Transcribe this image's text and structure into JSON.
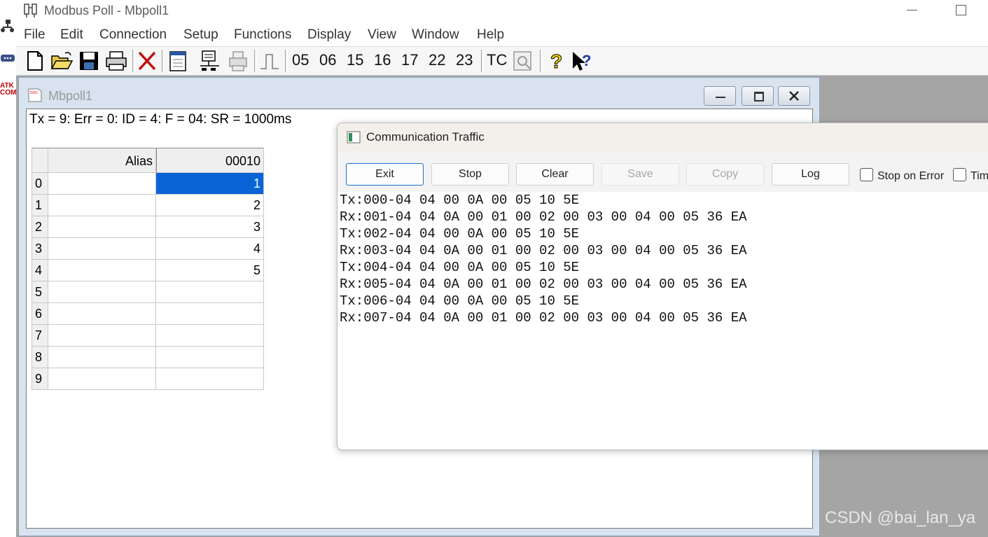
{
  "window": {
    "title": "Modbus Poll - Mbpoll1"
  },
  "desktop": {
    "icon_labels": [
      "ATK",
      "COM"
    ]
  },
  "menu": [
    "File",
    "Edit",
    "Connection",
    "Setup",
    "Functions",
    "Display",
    "View",
    "Window",
    "Help"
  ],
  "toolbar": {
    "function_codes": [
      "05",
      "06",
      "15",
      "16",
      "17",
      "22",
      "23"
    ],
    "tc_label": "TC",
    "icons": [
      "new-icon",
      "open-icon",
      "save-icon",
      "print-icon",
      "disconnect-icon",
      "window-icon",
      "read-write-icon",
      "printer-disabled-icon",
      "pulse-icon",
      "traffic-icon",
      "help-icon",
      "context-help-icon"
    ]
  },
  "child": {
    "title": "Mbpoll1",
    "status": "Tx = 9: Err = 0: ID = 4: F = 04: SR = 1000ms",
    "grid": {
      "headers": [
        "Alias",
        "00010"
      ],
      "rows": [
        {
          "index": "0",
          "alias": "",
          "value": "1"
        },
        {
          "index": "1",
          "alias": "",
          "value": "2"
        },
        {
          "index": "2",
          "alias": "",
          "value": "3"
        },
        {
          "index": "3",
          "alias": "",
          "value": "4"
        },
        {
          "index": "4",
          "alias": "",
          "value": "5"
        },
        {
          "index": "5",
          "alias": "",
          "value": ""
        },
        {
          "index": "6",
          "alias": "",
          "value": ""
        },
        {
          "index": "7",
          "alias": "",
          "value": ""
        },
        {
          "index": "8",
          "alias": "",
          "value": ""
        },
        {
          "index": "9",
          "alias": "",
          "value": ""
        }
      ],
      "selected_row": 0
    }
  },
  "traffic": {
    "title": "Communication Traffic",
    "buttons": {
      "exit": "Exit",
      "stop": "Stop",
      "clear": "Clear",
      "save": "Save",
      "copy": "Copy",
      "log": "Log"
    },
    "checkboxes": {
      "stop_on_error": "Stop on Error",
      "time": "Time"
    },
    "lines": [
      "Tx:000-04 04 00 0A 00 05 10 5E",
      "Rx:001-04 04 0A 00 01 00 02 00 03 00 04 00 05 36 EA",
      "Tx:002-04 04 00 0A 00 05 10 5E",
      "Rx:003-04 04 0A 00 01 00 02 00 03 00 04 00 05 36 EA",
      "Tx:004-04 04 00 0A 00 05 10 5E",
      "Rx:005-04 04 0A 00 01 00 02 00 03 00 04 00 05 36 EA",
      "Tx:006-04 04 00 0A 00 05 10 5E",
      "Rx:007-04 04 0A 00 01 00 02 00 03 00 04 00 05 36 EA"
    ]
  },
  "watermark": "CSDN @bai_lan_ya",
  "colors": {
    "selection": "#0a64d6",
    "mdi_background": "#a5a5a5",
    "primary_button_border": "#1a6fce"
  }
}
